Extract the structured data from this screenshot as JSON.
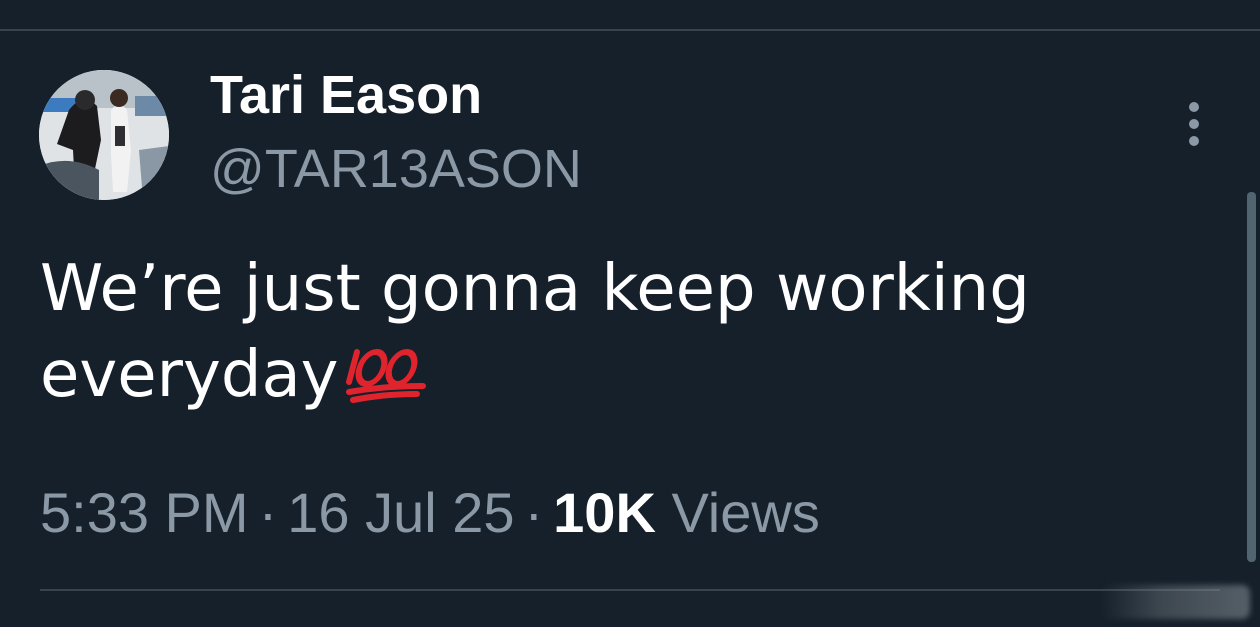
{
  "tweet": {
    "author": {
      "display_name": "Tari Eason",
      "handle": "@TAR13ASON",
      "avatar": "avatar-photo-basketball"
    },
    "text_line_1": "We’re just gonna keep working",
    "text_line_2": "everyday",
    "emoji": "hundred-points-emoji",
    "time": "5:33 PM",
    "separator": "·",
    "date": "16 Jul 25",
    "views_count": "10K",
    "views_label": "Views"
  },
  "icons": {
    "more": "more-vertical-icon"
  },
  "colors": {
    "background": "#15202b",
    "primary_text": "#ffffff",
    "secondary_text": "#8b98a5",
    "divider": "#38444d",
    "emoji_red": "#e0242e"
  }
}
